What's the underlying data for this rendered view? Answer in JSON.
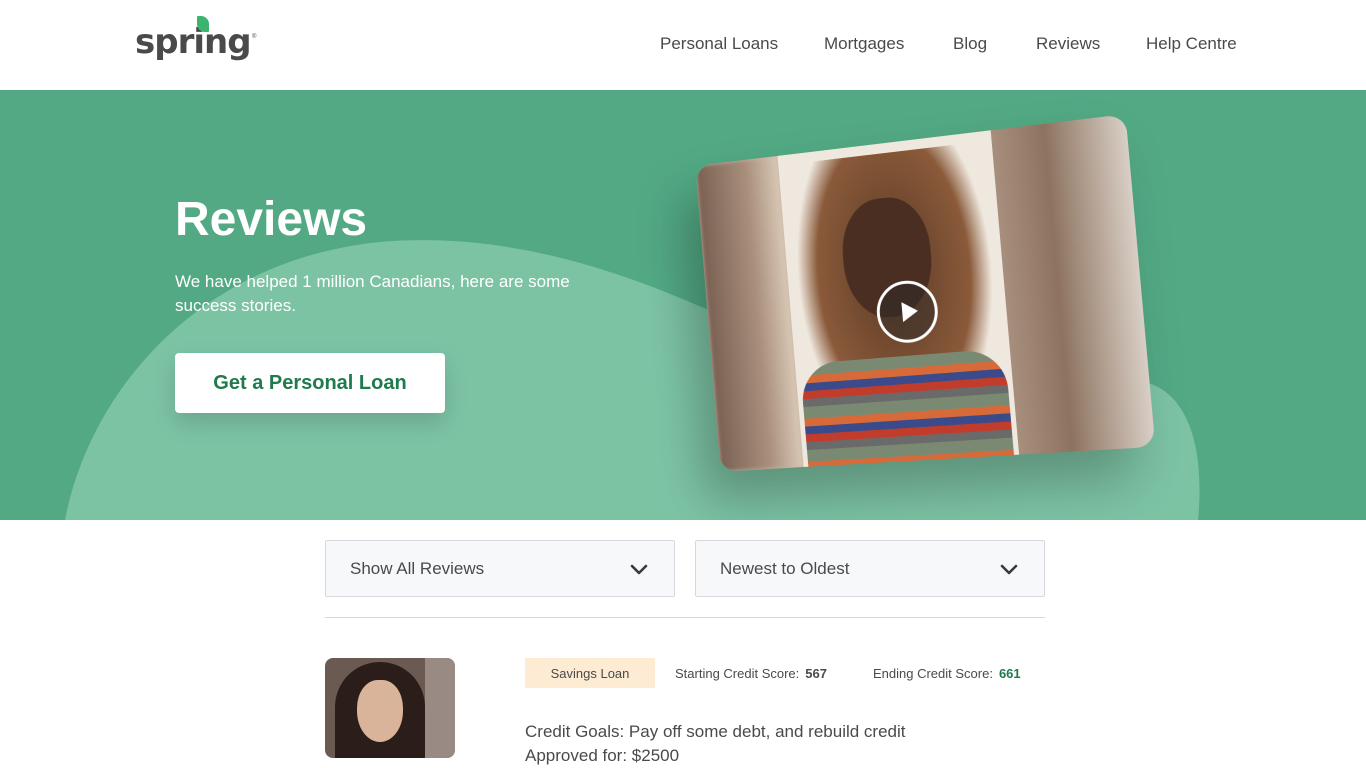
{
  "header": {
    "logo": "spring",
    "nav": [
      "Personal Loans",
      "Mortgages",
      "Blog",
      "Reviews",
      "Help Centre"
    ]
  },
  "hero": {
    "title": "Reviews",
    "subtitle": "We have helped 1 million Canadians, here are some success stories.",
    "cta_label": "Get a Personal Loan",
    "video_icon": "play-icon"
  },
  "filters": {
    "type_selected": "Show All Reviews",
    "sort_selected": "Newest to Oldest"
  },
  "review": {
    "loan_type": "Savings Loan",
    "starting_label": "Starting Credit Score:",
    "starting_value": "567",
    "ending_label": "Ending Credit Score:",
    "ending_value": "661",
    "goals": "Credit Goals: Pay off some debt, and rebuild credit",
    "approved": "Approved for: $2500"
  },
  "colors": {
    "brand_green": "#52a984",
    "light_green": "#7cc3a4",
    "dark_green": "#1f7a4d",
    "badge_bg": "#fdebd3"
  }
}
